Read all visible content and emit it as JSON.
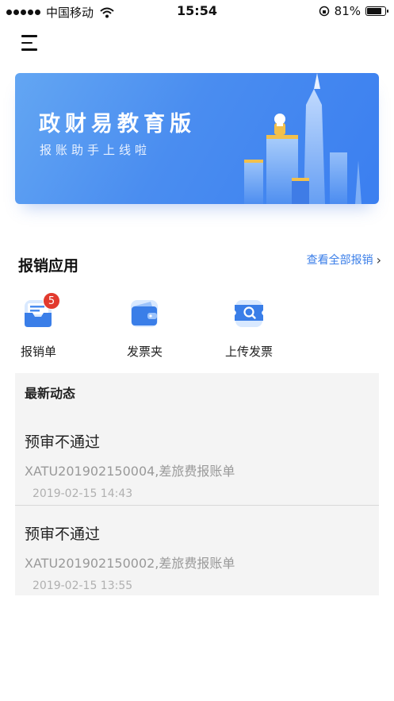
{
  "status_bar": {
    "carrier": "中国移动",
    "time": "15:54",
    "battery": "81%",
    "battery_level": 0.81
  },
  "banner": {
    "title": "政财易教育版",
    "subtitle": "报账助手上线啦"
  },
  "apps_section": {
    "title": "报销应用",
    "view_all": "查看全部报销"
  },
  "apps": [
    {
      "label": "报销单",
      "badge": "5",
      "icon": "document-inbox-icon"
    },
    {
      "label": "发票夹",
      "icon": "wallet-icon"
    },
    {
      "label": "上传发票",
      "icon": "ticket-search-icon"
    }
  ],
  "feed": {
    "title": "最新动态",
    "items": [
      {
        "status": "预审不通过",
        "desc": "XATU201902150004,差旅费报账单",
        "time": "2019-02-15 14:43"
      },
      {
        "status": "预审不通过",
        "desc": "XATU201902150002,差旅费报账单",
        "time": "2019-02-15 13:55"
      }
    ]
  },
  "colors": {
    "accent": "#3a7ee8",
    "badge": "#e23a2e",
    "banner": "#4a8df0"
  }
}
